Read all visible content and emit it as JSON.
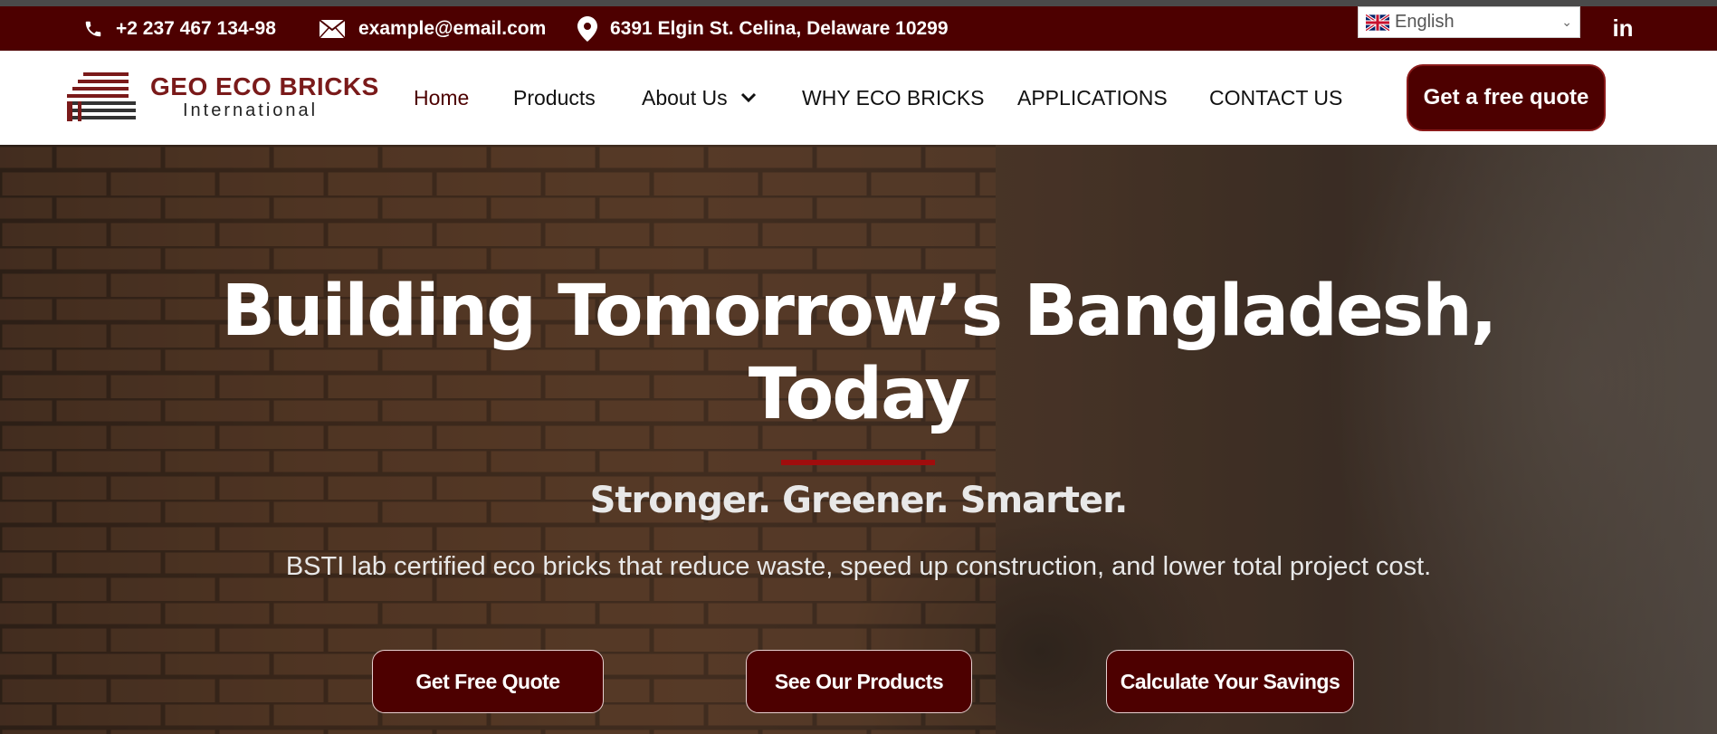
{
  "topbar": {
    "phone": "+2 237 467 134-98",
    "email": "example@email.com",
    "address": "6391 Elgin St. Celina, Delaware 10299",
    "language": "English",
    "social": "in"
  },
  "brand": {
    "name": "GEO ECO BRICKS",
    "sub": "International"
  },
  "nav": {
    "items": [
      {
        "label": "Home"
      },
      {
        "label": "Products"
      },
      {
        "label": "About Us"
      },
      {
        "label": "WHY ECO BRICKS"
      },
      {
        "label": "APPLICATIONS"
      },
      {
        "label": "CONTACT US"
      }
    ],
    "cta": "Get a free quote"
  },
  "hero": {
    "title_line1": "Building Tomorrow’s Bangladesh,",
    "title_line2": "Today",
    "tagline": "Stronger. Greener. Smarter.",
    "description": "BSTI lab certified eco bricks that reduce waste, speed up construction, and lower total project cost.",
    "buttons": [
      {
        "label": "Get Free Quote"
      },
      {
        "label": "See Our Products"
      },
      {
        "label": "Calculate Your Savings"
      }
    ]
  },
  "colors": {
    "brand_dark": "#4d0000",
    "accent_red": "#a00d0d",
    "logo_red": "#7a1a1a"
  },
  "icons": [
    "phone-icon",
    "mail-icon",
    "location-pin-icon",
    "uk-flag-icon",
    "chevron-down-icon",
    "linkedin-icon"
  ]
}
